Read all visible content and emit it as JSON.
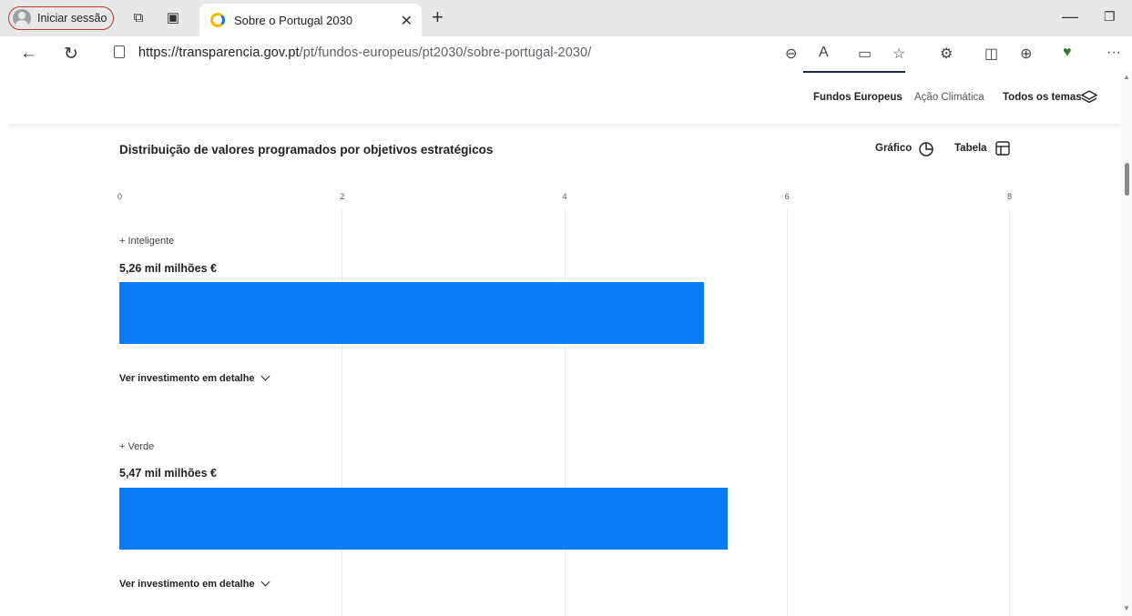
{
  "browser": {
    "profile_label": "Iniciar sessão",
    "tab_title": "Sobre o Portugal 2030",
    "url_host": "https://transparencia.gov.pt",
    "url_path": "/pt/fundos-europeus/pt2030/sobre-portugal-2030/"
  },
  "site_nav": {
    "items": [
      "Fundos Europeus",
      "Ação Climática",
      "Todos os temas"
    ]
  },
  "chart_header": {
    "title": "Distribuição de valores programados por objetivos estratégicos",
    "grafico_label": "Gráfico",
    "tabela_label": "Tabela"
  },
  "chart_data": {
    "type": "bar",
    "orientation": "horizontal",
    "title": "Distribuição de valores programados por objetivos estratégicos",
    "x_ticks": [
      "0",
      "2",
      "4",
      "6",
      "8"
    ],
    "xlim": [
      0,
      8
    ],
    "categories": [
      "+ Inteligente",
      "+ Verde"
    ],
    "values": [
      5.26,
      5.47
    ],
    "value_labels": [
      "5,26 mil milhões €",
      "5,47 mil milhões €"
    ],
    "detail_label": "Ver investimento em detalhe",
    "bar_color": "#0a7cf5",
    "grid": true
  }
}
